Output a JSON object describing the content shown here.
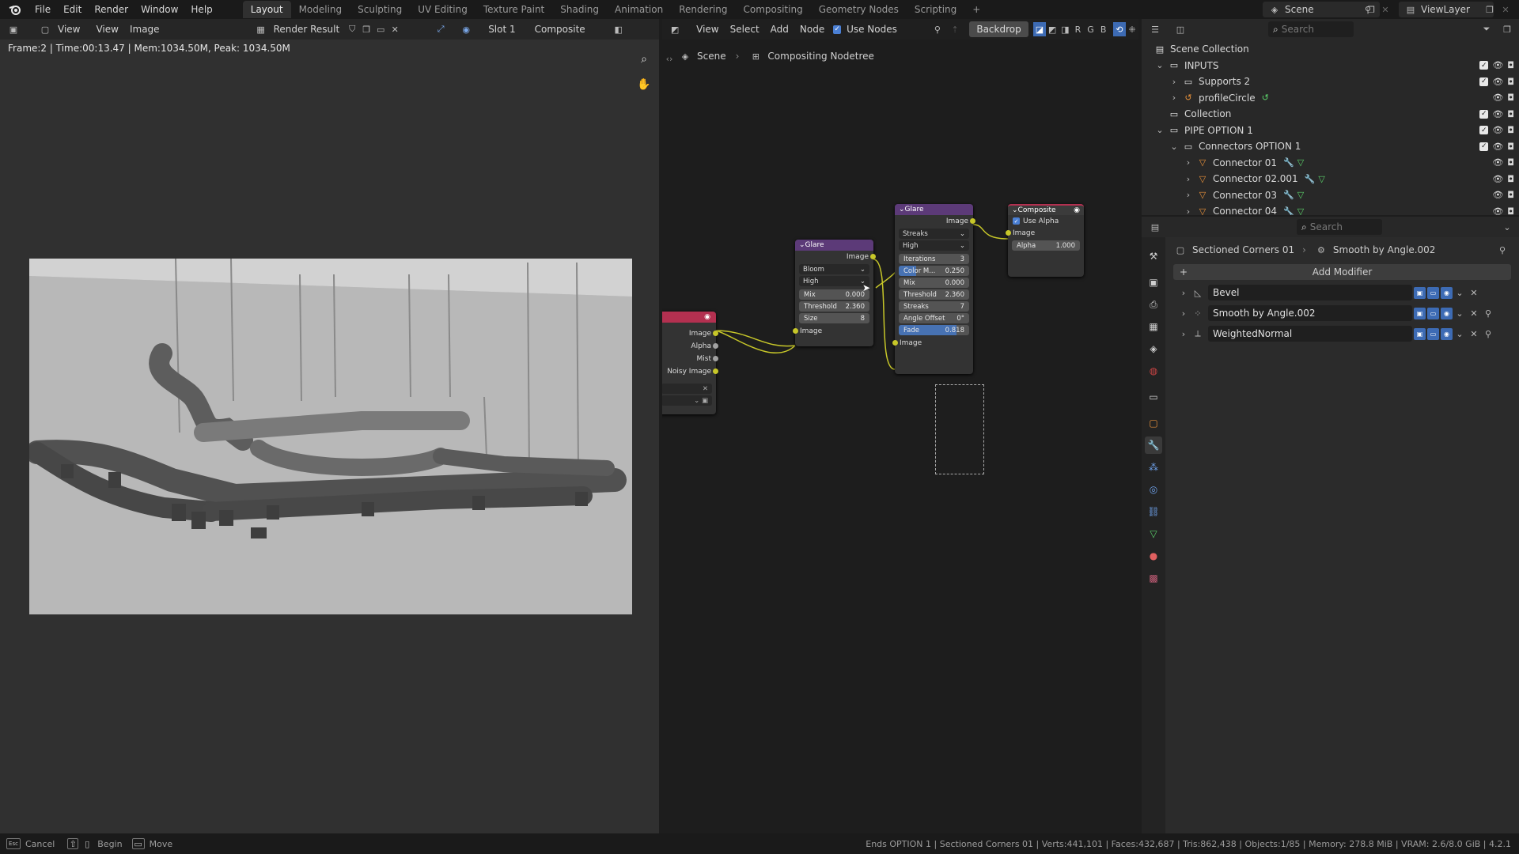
{
  "topbar": {
    "menus": [
      "File",
      "Edit",
      "Render",
      "Window",
      "Help"
    ],
    "workspaces": [
      "Layout",
      "Modeling",
      "Sculpting",
      "UV Editing",
      "Texture Paint",
      "Shading",
      "Animation",
      "Rendering",
      "Compositing",
      "Geometry Nodes",
      "Scripting"
    ],
    "active_workspace": "Layout",
    "add_tab": "+",
    "scene": "Scene",
    "view_layer": "ViewLayer"
  },
  "image_editor": {
    "menus": [
      "View",
      "View",
      "Image"
    ],
    "image_name": "Render Result",
    "slot": "Slot 1",
    "layer": "Composite",
    "info": "Frame:2 | Time:00:13.47 | Mem:1034.50M, Peak: 1034.50M"
  },
  "node_editor": {
    "menus": [
      "View",
      "Select",
      "Add",
      "Node"
    ],
    "use_nodes_label": "Use Nodes",
    "use_nodes": true,
    "backdrop_label": "Backdrop",
    "channels": [
      "R",
      "G",
      "B"
    ],
    "breadcrumb": [
      "Scene",
      "Compositing Nodetree"
    ],
    "render_layers": {
      "outputs": [
        "Image",
        "Alpha",
        "Mist",
        "Noisy Image"
      ]
    },
    "glare1": {
      "title": "Glare",
      "output": "Image",
      "type": "Bloom",
      "quality": "High",
      "mix_label": "Mix",
      "mix": "0.000",
      "threshold_label": "Threshold",
      "threshold": "2.360",
      "size_label": "Size",
      "size": "8",
      "input": "Image"
    },
    "glare2": {
      "title": "Glare",
      "output": "Image",
      "type": "Streaks",
      "quality": "High",
      "iterations_label": "Iterations",
      "iterations": "3",
      "color_mod_label": "Color M...",
      "color_mod": "0.250",
      "color_mod_fraction": 0.25,
      "mix_label": "Mix",
      "mix": "0.000",
      "threshold_label": "Threshold",
      "threshold": "2.360",
      "streaks_label": "Streaks",
      "streaks": "7",
      "angle_label": "Angle Offset",
      "angle": "0°",
      "fade_label": "Fade",
      "fade": "0.818",
      "fade_fraction": 0.818,
      "input": "Image"
    },
    "composite": {
      "title": "Composite",
      "use_alpha_label": "Use Alpha",
      "use_alpha": true,
      "image_label": "Image",
      "alpha_label": "Alpha",
      "alpha": "1.000"
    }
  },
  "outliner": {
    "search_placeholder": "Search",
    "items": [
      {
        "label": "Scene Collection",
        "indent": 0,
        "icon": "scene-collection"
      },
      {
        "label": "INPUTS",
        "indent": 1,
        "icon": "collection",
        "expanded": true
      },
      {
        "label": "Supports 2",
        "indent": 2,
        "icon": "collection"
      },
      {
        "label": "profileCircle",
        "indent": 2,
        "icon": "curve"
      },
      {
        "label": "Collection",
        "indent": 1,
        "icon": "collection"
      },
      {
        "label": "PIPE OPTION 1",
        "indent": 1,
        "icon": "collection",
        "expanded": true
      },
      {
        "label": "Connectors OPTION 1",
        "indent": 2,
        "icon": "collection",
        "expanded": true
      },
      {
        "label": "Connector 01",
        "indent": 3,
        "icon": "mesh"
      },
      {
        "label": "Connector 02.001",
        "indent": 3,
        "icon": "mesh"
      },
      {
        "label": "Connector 03",
        "indent": 3,
        "icon": "mesh"
      },
      {
        "label": "Connector 04",
        "indent": 3,
        "icon": "mesh"
      }
    ]
  },
  "properties": {
    "search_placeholder": "Search",
    "breadcrumb": [
      "Sectioned Corners 01",
      "Smooth by Angle.002"
    ],
    "add_modifier": "Add Modifier",
    "modifiers": [
      {
        "name": "Bevel"
      },
      {
        "name": "Smooth by Angle.002"
      },
      {
        "name": "WeightedNormal"
      }
    ]
  },
  "statusbar": {
    "cancel": "Cancel",
    "begin": "Begin",
    "move": "Move",
    "stats": "Ends OPTION 1 | Sectioned Corners 01 | Verts:441,101 | Faces:432,687 | Tris:862,438 | Objects:1/85 | Memory: 278.8 MiB | VRAM: 2.6/8.0 GiB | 4.2.1"
  }
}
